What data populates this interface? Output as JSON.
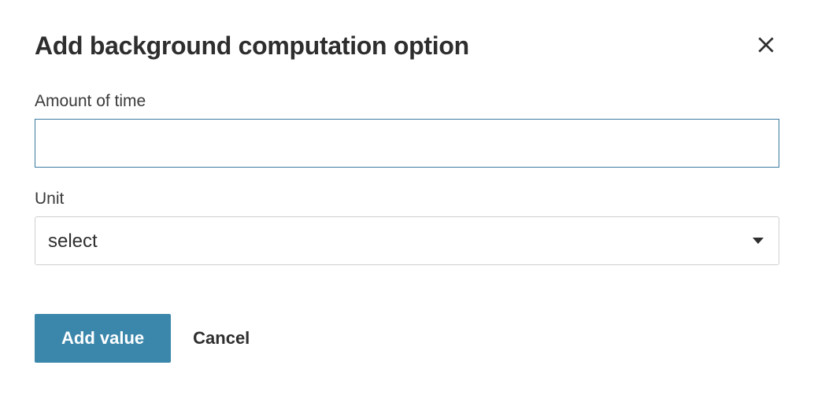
{
  "dialog": {
    "title": "Add background computation option",
    "fields": {
      "amount": {
        "label": "Amount of time",
        "value": ""
      },
      "unit": {
        "label": "Unit",
        "selected": "select"
      }
    },
    "actions": {
      "submit_label": "Add value",
      "cancel_label": "Cancel"
    }
  }
}
